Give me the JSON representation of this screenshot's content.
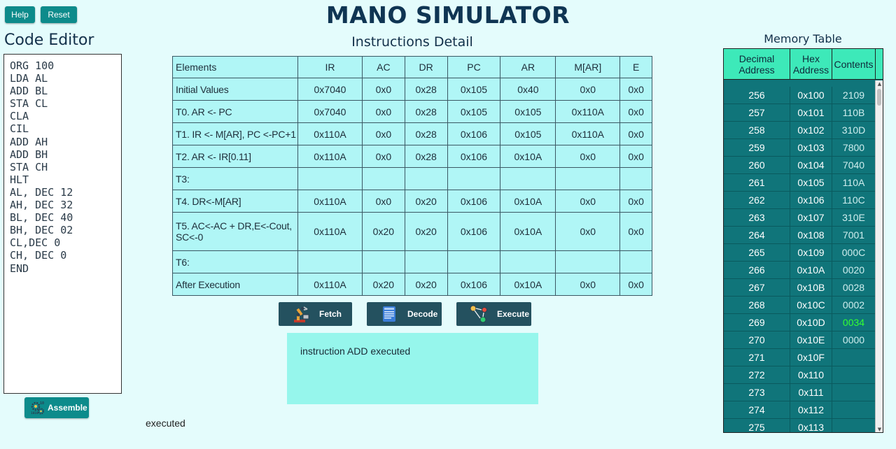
{
  "header": {
    "title": "MANO SIMULATOR",
    "help_label": "Help",
    "reset_label": "Reset"
  },
  "editor": {
    "title": "Code Editor",
    "code": "ORG 100\nLDA AL\nADD BL\nSTA CL\nCLA\nCIL\nADD AH\nADD BH\nSTA CH\nHLT\nAL, DEC 12\nAH, DEC 32\nBL, DEC 40\nBH, DEC 02\nCL,DEC 0\nCH, DEC 0\nEND",
    "assemble_label": "Assemble"
  },
  "status": "executed",
  "instructions": {
    "title": "Instructions Detail",
    "columns": [
      "Elements",
      "IR",
      "AC",
      "DR",
      "PC",
      "AR",
      "M[AR]",
      "E"
    ],
    "rows": [
      [
        "Initial Values",
        "0x7040",
        "0x0",
        "0x28",
        "0x105",
        "0x40",
        "0x0",
        "0x0"
      ],
      [
        "T0. AR <- PC",
        "0x7040",
        "0x0",
        "0x28",
        "0x105",
        "0x105",
        "0x110A",
        "0x0"
      ],
      [
        "T1. IR <- M[AR], PC <-PC+1",
        "0x110A",
        "0x0",
        "0x28",
        "0x106",
        "0x105",
        "0x110A",
        "0x0"
      ],
      [
        "T2. AR <- IR[0.11]",
        "0x110A",
        "0x0",
        "0x28",
        "0x106",
        "0x10A",
        "0x0",
        "0x0"
      ],
      [
        "T3:",
        "",
        "",
        "",
        "",
        "",
        "",
        ""
      ],
      [
        "T4. DR<-M[AR]",
        "0x110A",
        "0x0",
        "0x20",
        "0x106",
        "0x10A",
        "0x0",
        "0x0"
      ],
      [
        "T5. AC<-AC + DR,E<-Cout, SC<-0",
        "0x110A",
        "0x20",
        "0x20",
        "0x106",
        "0x10A",
        "0x0",
        "0x0"
      ],
      [
        "T6:",
        "",
        "",
        "",
        "",
        "",
        "",
        ""
      ],
      [
        "After Execution",
        "0x110A",
        "0x20",
        "0x20",
        "0x106",
        "0x10A",
        "0x0",
        "0x0"
      ]
    ]
  },
  "controls": {
    "fetch_label": "Fetch",
    "decode_label": "Decode",
    "execute_label": "Execute"
  },
  "message": "instruction ADD executed",
  "memory": {
    "title": "Memory Table",
    "headers": [
      "Decimal Address",
      "Hex Address",
      "Contents"
    ],
    "highlight_color": "#33ff33",
    "rows": [
      {
        "dec": "256",
        "hex": "0x100",
        "content": "2109"
      },
      {
        "dec": "257",
        "hex": "0x101",
        "content": "110B"
      },
      {
        "dec": "258",
        "hex": "0x102",
        "content": "310D"
      },
      {
        "dec": "259",
        "hex": "0x103",
        "content": "7800"
      },
      {
        "dec": "260",
        "hex": "0x104",
        "content": "7040"
      },
      {
        "dec": "261",
        "hex": "0x105",
        "content": "110A"
      },
      {
        "dec": "262",
        "hex": "0x106",
        "content": "110C"
      },
      {
        "dec": "263",
        "hex": "0x107",
        "content": "310E"
      },
      {
        "dec": "264",
        "hex": "0x108",
        "content": "7001"
      },
      {
        "dec": "265",
        "hex": "0x109",
        "content": "000C"
      },
      {
        "dec": "266",
        "hex": "0x10A",
        "content": "0020"
      },
      {
        "dec": "267",
        "hex": "0x10B",
        "content": "0028"
      },
      {
        "dec": "268",
        "hex": "0x10C",
        "content": "0002"
      },
      {
        "dec": "269",
        "hex": "0x10D",
        "content": "0034",
        "highlight": true
      },
      {
        "dec": "270",
        "hex": "0x10E",
        "content": "0000"
      },
      {
        "dec": "271",
        "hex": "0x10F",
        "content": ""
      },
      {
        "dec": "272",
        "hex": "0x110",
        "content": ""
      },
      {
        "dec": "273",
        "hex": "0x111",
        "content": ""
      },
      {
        "dec": "274",
        "hex": "0x112",
        "content": ""
      },
      {
        "dec": "275",
        "hex": "0x113",
        "content": ""
      }
    ]
  }
}
